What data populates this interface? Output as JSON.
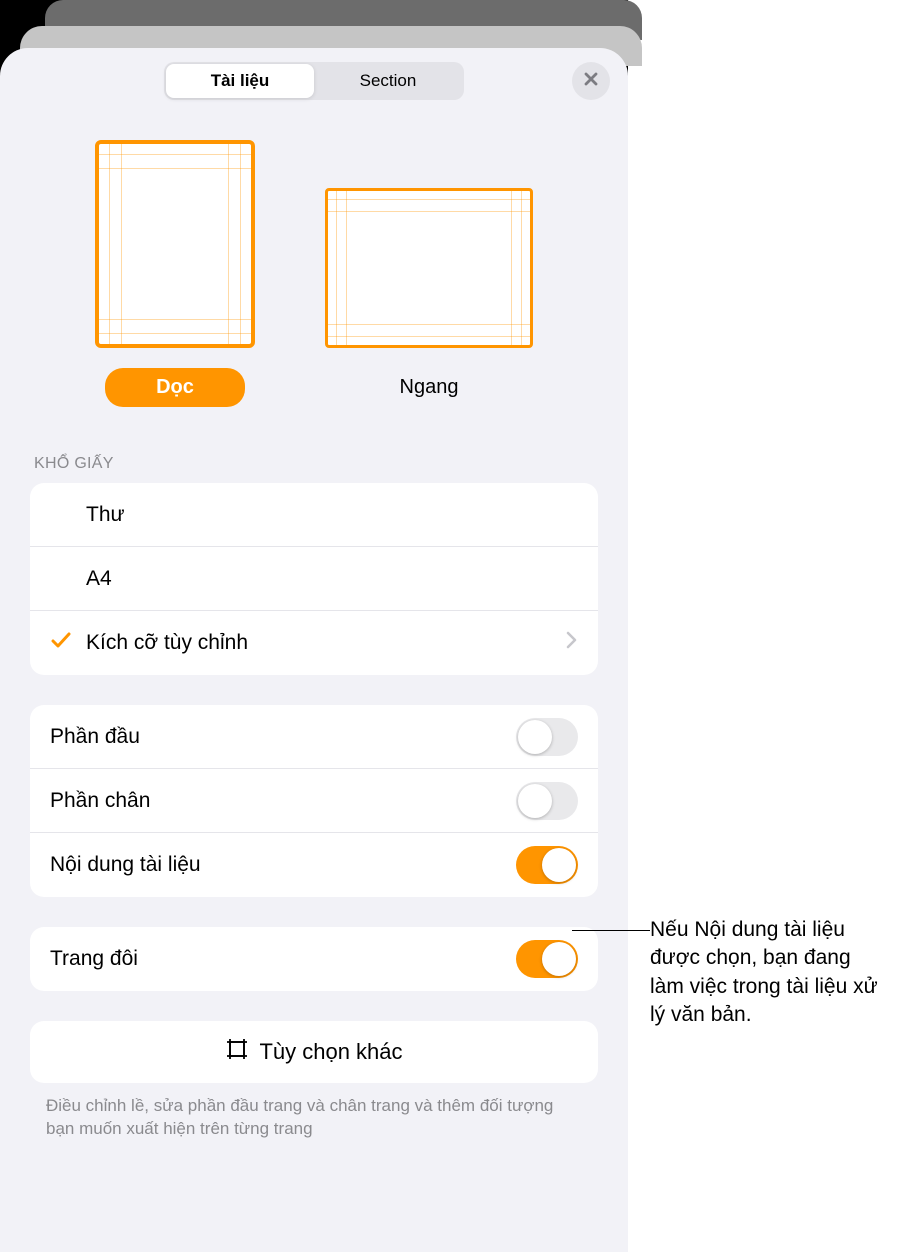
{
  "tabs": {
    "document": "Tài liệu",
    "section": "Section"
  },
  "orientation": {
    "portrait": "Dọc",
    "landscape": "Ngang"
  },
  "paperSize": {
    "header": "KHỔ GIẤY",
    "letter": "Thư",
    "a4": "A4",
    "custom": "Kích cỡ tùy chỉnh"
  },
  "toggles": {
    "header": "Phần đầu",
    "footer": "Phần chân",
    "bodyContent": "Nội dung tài liệu",
    "facingPages": "Trang đôi"
  },
  "moreOptions": "Tùy chọn khác",
  "footerNote": "Điều chỉnh lề, sửa phần đầu trang và chân trang và thêm đối tượng bạn muốn xuất hiện trên từng trang",
  "callout": "Nếu Nội dung tài liệu được chọn, bạn đang làm việc trong tài liệu xử lý văn bản."
}
